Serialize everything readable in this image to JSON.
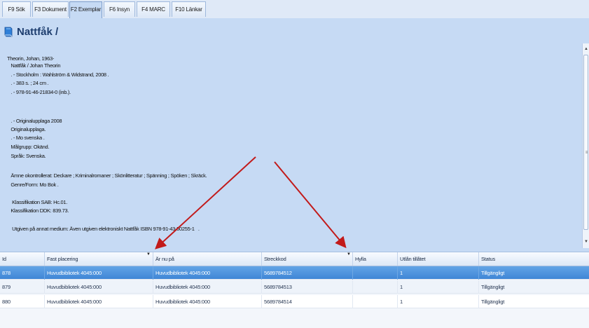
{
  "tabs": [
    {
      "label": "F9 Sök"
    },
    {
      "label": "F3 Dokument"
    },
    {
      "label": "F2 Exemplar"
    },
    {
      "label": "F6 Insyn"
    },
    {
      "label": "F4 MARC"
    },
    {
      "label": "F10 Länkar"
    }
  ],
  "active_tab": "F2 Exemplar",
  "title": "Nattfåk /",
  "record_lines": [
    "Theorin, Johan, 1963-",
    "   Nattfåk / Johan Theorin",
    "   . - Stockholm : Wahlström & Widstrand, 2008 .",
    "   . - 383 s. ; 24 cm .",
    "   . - 978-91-46-21834-0 (inb.).",
    "   . - Originalupplaga 2008",
    "   Originalupplaga.",
    "   . - Mo svenska .",
    "   Målgrupp: Okänd.",
    "   Språk: Svenska.",
    "   Ämne okontrollerat: Deckare ; Kriminalromaner ; Skönlitteratur ; Spänning ; Spöken ; Skräck.",
    "   Genre/Form: Mo Bok .",
    "    Klassifikation SAB: Hc.01.",
    "   Klassifikation DDK: 839.73.",
    "    Utgiven på annat medium: Även utgiven elektroniskt Nattfåk ISBN 978-91-43-50255-1   ."
  ],
  "grid": {
    "columns": [
      "Id",
      "Fast placering",
      "Är nu på",
      "Streckkod",
      "Hylla",
      "Utlån tillåtet",
      "Status"
    ],
    "rows": [
      [
        "878",
        "Huvudbibliotek 4045:000",
        "Huvudbibliotek 4045:000",
        "5689784512",
        "",
        "1",
        "Tillgängligt"
      ],
      [
        "879",
        "Huvudbibliotek 4045:000",
        "Huvudbibliotek 4045:000",
        "5689784513",
        "",
        "1",
        "Tillgängligt"
      ],
      [
        "880",
        "Huvudbibliotek 4045:000",
        "Huvudbibliotek 4045:000",
        "5689784514",
        "",
        "1",
        "Tillgängligt"
      ]
    ],
    "selected_row": 0
  },
  "colors": {
    "background": "#c6daf4",
    "selected_row": "#4a90dc",
    "annotation_arrow": "#c21a1a",
    "title": "#1d3d6e"
  },
  "icons": {
    "title_icon": "book-icon",
    "sort_indicator": "dropdown-arrow-icon"
  }
}
